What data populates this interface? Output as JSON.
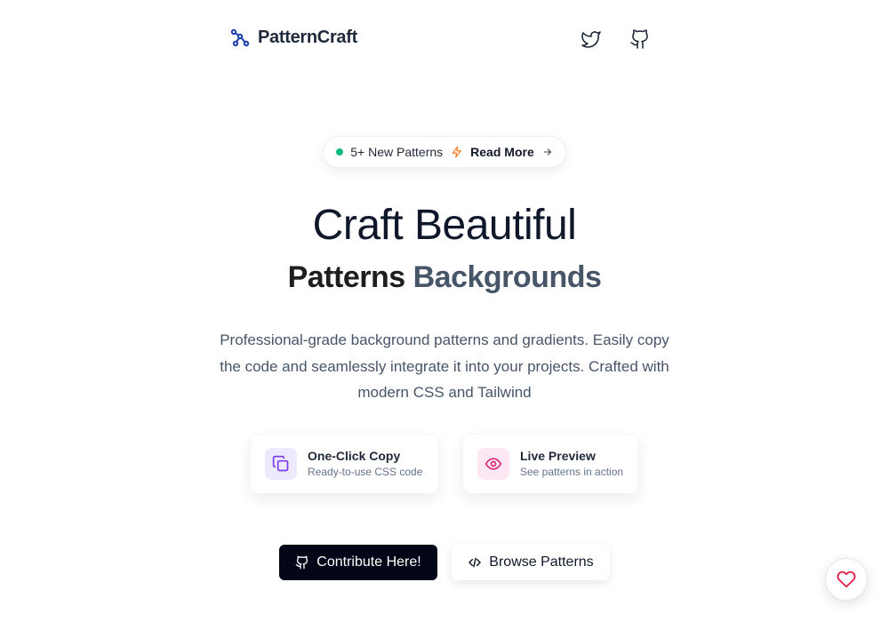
{
  "header": {
    "brand_name": "PatternCraft",
    "brand_icon": "nodes-icon",
    "social_icons": [
      "twitter-icon",
      "github-icon"
    ]
  },
  "announcement": {
    "badge_text": "5+ New Patterns",
    "link_text": "Read More",
    "dot_color": "#10b981",
    "spark_color": "#f97316"
  },
  "hero": {
    "title": "Craft Beautiful",
    "subtitle_word_1": "Patterns",
    "subtitle_word_2": "Backgrounds",
    "description": "Professional-grade background patterns and gradients. Easily copy the code and seamlessly integrate it into your projects. Crafted with modern CSS and Tailwind"
  },
  "features": [
    {
      "title": "One-Click Copy",
      "text": "Ready-to-use CSS code",
      "icon": "copy-icon"
    },
    {
      "title": "Live Preview",
      "text": "See patterns in action",
      "icon": "eye-icon"
    }
  ],
  "actions": {
    "contribute_label": "Contribute Here!",
    "browse_label": "Browse Patterns"
  },
  "colors": {
    "brand_accent": "#1e40af",
    "primary_button": "#020617",
    "heart": "#e11d48"
  }
}
